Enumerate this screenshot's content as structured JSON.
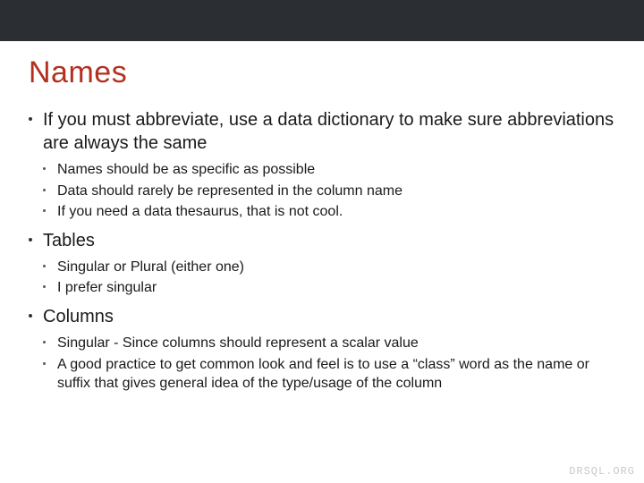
{
  "title": "Names",
  "items": [
    {
      "text": "If you must abbreviate, use a data dictionary to make sure abbreviations are always the same",
      "sub": [
        "Names should be as specific as possible",
        "Data should rarely be represented in the column name",
        "If you need a data thesaurus, that is not cool."
      ]
    },
    {
      "text": "Tables",
      "sub": [
        "Singular or Plural (either one)",
        "I prefer singular"
      ]
    },
    {
      "text": "Columns",
      "sub": [
        "Singular - Since columns should represent a scalar value",
        "A good practice to get common look and feel is to use a “class” word as the name or suffix that gives general idea of the type/usage of the column"
      ]
    }
  ],
  "watermark": "DRSQL.ORG"
}
